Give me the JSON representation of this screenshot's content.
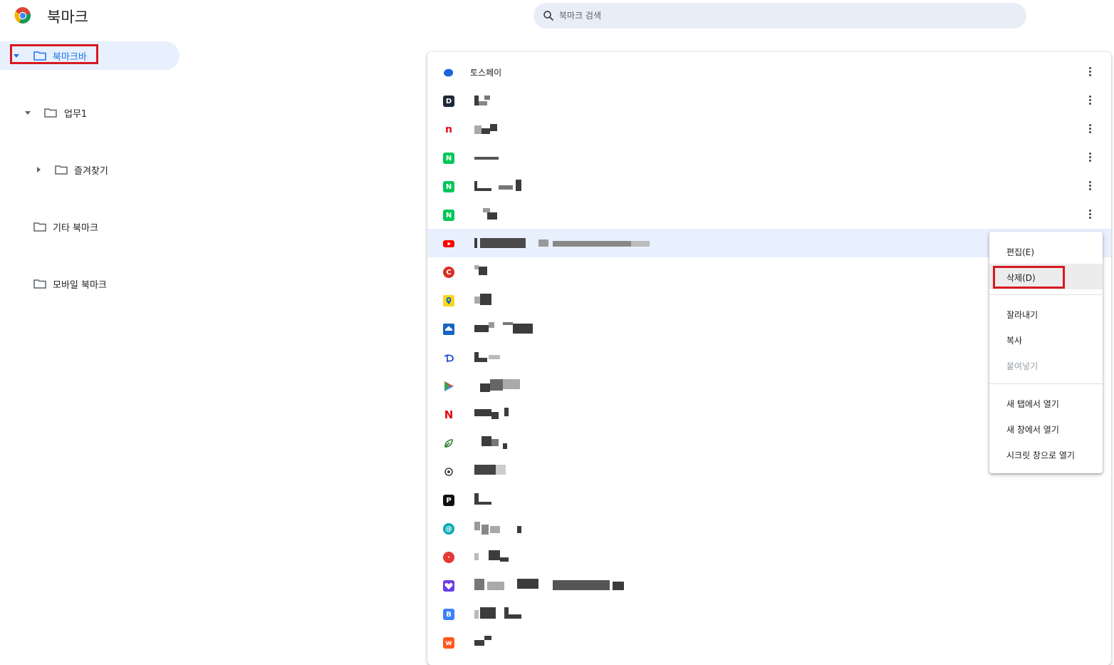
{
  "app": {
    "title": "북마크",
    "icon": "chrome-logo-icon"
  },
  "search": {
    "placeholder": "북마크 검색",
    "icon": "search-icon"
  },
  "sidebar": {
    "items": [
      {
        "label": "북마크바",
        "icon": "folder-icon",
        "expanded": true,
        "selected": true
      },
      {
        "label": "업무1",
        "icon": "folder-icon",
        "expanded": true
      },
      {
        "label": "즐겨찾기",
        "icon": "folder-icon",
        "expanded": false
      },
      {
        "label": "기타 북마크",
        "icon": "folder-icon"
      },
      {
        "label": "모바일 북마크",
        "icon": "folder-icon"
      }
    ]
  },
  "bookmarks": [
    {
      "title": "토스페이",
      "icon": "tosspay-icon",
      "color": "#1b64da"
    },
    {
      "title": "",
      "icon": "d-letter-icon",
      "color": "#1f2937"
    },
    {
      "title": "",
      "icon": "n-red-icon",
      "color": "#e50914"
    },
    {
      "title": "",
      "icon": "naver-icon",
      "color": "#03c75a"
    },
    {
      "title": "",
      "icon": "naver-icon",
      "color": "#03c75a"
    },
    {
      "title": "",
      "icon": "naver-icon",
      "color": "#03c75a"
    },
    {
      "title": "",
      "icon": "youtube-icon",
      "color": "#ff0000"
    },
    {
      "title": "",
      "icon": "c-circle-icon",
      "color": "#d93025"
    },
    {
      "title": "",
      "icon": "map-pin-icon",
      "color": "#f9d71c"
    },
    {
      "title": "",
      "icon": "house-icon",
      "color": "#1565c0"
    },
    {
      "title": "",
      "icon": "disney-icon",
      "color": "#113ccf"
    },
    {
      "title": "",
      "icon": "play-triangle-icon",
      "color": "#4285f4"
    },
    {
      "title": "",
      "icon": "netflix-icon",
      "color": "#e50914"
    },
    {
      "title": "",
      "icon": "leaf-icon",
      "color": "#2e7d32"
    },
    {
      "title": "",
      "icon": "openai-icon",
      "color": "#444444"
    },
    {
      "title": "",
      "icon": "p-letter-icon",
      "color": "#111111"
    },
    {
      "title": "",
      "icon": "swirl-icon",
      "color": "#00a8b5"
    },
    {
      "title": "",
      "icon": "red-circle-icon",
      "color": "#e53935"
    },
    {
      "title": "",
      "icon": "heart-icon",
      "color": "#6a3de8"
    },
    {
      "title": "",
      "icon": "b-letter-icon",
      "color": "#3b82f6"
    },
    {
      "title": "",
      "icon": "w-letter-icon",
      "color": "#ff5a1f"
    }
  ],
  "context_menu": {
    "items": [
      {
        "label": "편집(E)"
      },
      {
        "label": "삭제(D)",
        "hovered": true
      },
      {
        "label": "잘라내기"
      },
      {
        "label": "복사"
      },
      {
        "label": "붙여넣기",
        "disabled": true
      },
      {
        "label": "새 탭에서 열기"
      },
      {
        "label": "새 창에서 열기"
      },
      {
        "label": "시크릿 창으로 열기"
      }
    ]
  },
  "colors": {
    "accent": "#1a73e8",
    "selected_bg": "#e8f0fe",
    "search_bg": "#e8edf7",
    "highlight": "#d71920"
  }
}
